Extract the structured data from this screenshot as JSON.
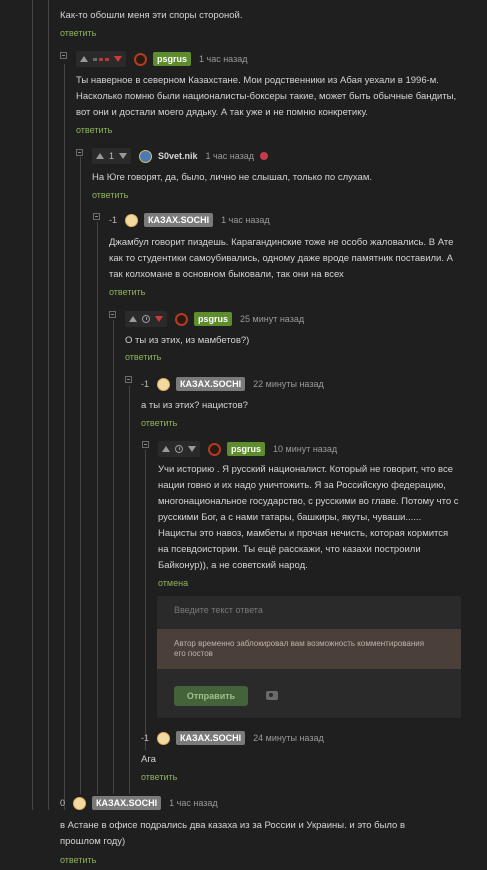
{
  "comments": [
    {
      "text": "Как-то обошли меня эти споры стороной.",
      "reply": "ответить"
    },
    {
      "nick": "psgrus",
      "time": "1 час назад",
      "lines": [
        "Ты наверное в северном Казахстане. Мои родственники из Абая уехали в 1996-м.",
        "Насколько помню были националисты-боксеры такие, может быть обычные бандиты,",
        "вот они и достали моего дядьку. А так уже и не помню конкретику."
      ],
      "reply": "ответить"
    },
    {
      "score": "1",
      "nick": "S0vet.nik",
      "time": "1 час назад",
      "lines": [
        "На Юге говорят, да, было, лично не слышал, только по слухам."
      ],
      "reply": "ответить"
    },
    {
      "score": "-1",
      "nick": "КАЗАХ.SOCHI",
      "time": "1 час назад",
      "lines": [
        "Джамбул говорит пиздешь. Карагандинские тоже не особо жаловались. В Ате",
        "как то студентики самоубивались, одному даже вроде памятник поставили. А",
        "так колхомане в основном быковали, так они на всех"
      ],
      "reply": "ответить"
    },
    {
      "nick": "psgrus",
      "time": "25 минут назад",
      "lines": [
        "О ты из этих, из мамбетов?)"
      ],
      "reply": "ответить"
    },
    {
      "score": "-1",
      "nick": "КАЗАХ.SOCHI",
      "time": "22 минуты назад",
      "lines": [
        "а ты из этих? нацистов?"
      ],
      "reply": "ответить"
    },
    {
      "nick": "psgrus",
      "time": "10 минут назад",
      "lines": [
        "Учи историю . Я русский националист. Который не говорит, что все",
        "нации говно и их надо уничтожить. Я за Российскую федерацию,",
        "многонациональное государство, с русскими во главе. Потому что с",
        "русскими Бог, а с нами татары, башкиры, якуты, чуваши......",
        "Нацисты это навоз, мамбеты и прочая нечисть, которая кормится",
        "на псевдоистории. Ты ещё расскажи, что казахи построили",
        "Байконур)), а не советский народ."
      ],
      "reply": "отмена"
    },
    {
      "score": "-1",
      "nick": "КАЗАХ.SOCHI",
      "time": "24 минуты назад",
      "lines": [
        "Ага"
      ],
      "reply": "ответить"
    },
    {
      "score": "0",
      "nick": "КАЗАХ.SOCHI",
      "time": "1 час назад",
      "lines": [
        "в Астане в офисе подрались два казаха из за России и Украины. и это было в",
        "прошлом году)"
      ],
      "reply": "ответить"
    }
  ],
  "reply_form": {
    "placeholder": "Введите текст ответа",
    "blocked_line1": "Автор временно заблокировал вам возможность комментирования",
    "blocked_line2": "его постов",
    "send_label": "Отправить",
    "camera_icon": "camera-icon"
  },
  "colors": {
    "accent_green": "#5e8d2e",
    "reply_link": "#8bb55a",
    "downvote_red": "#d23a3a",
    "background": "#1f1f1f"
  }
}
